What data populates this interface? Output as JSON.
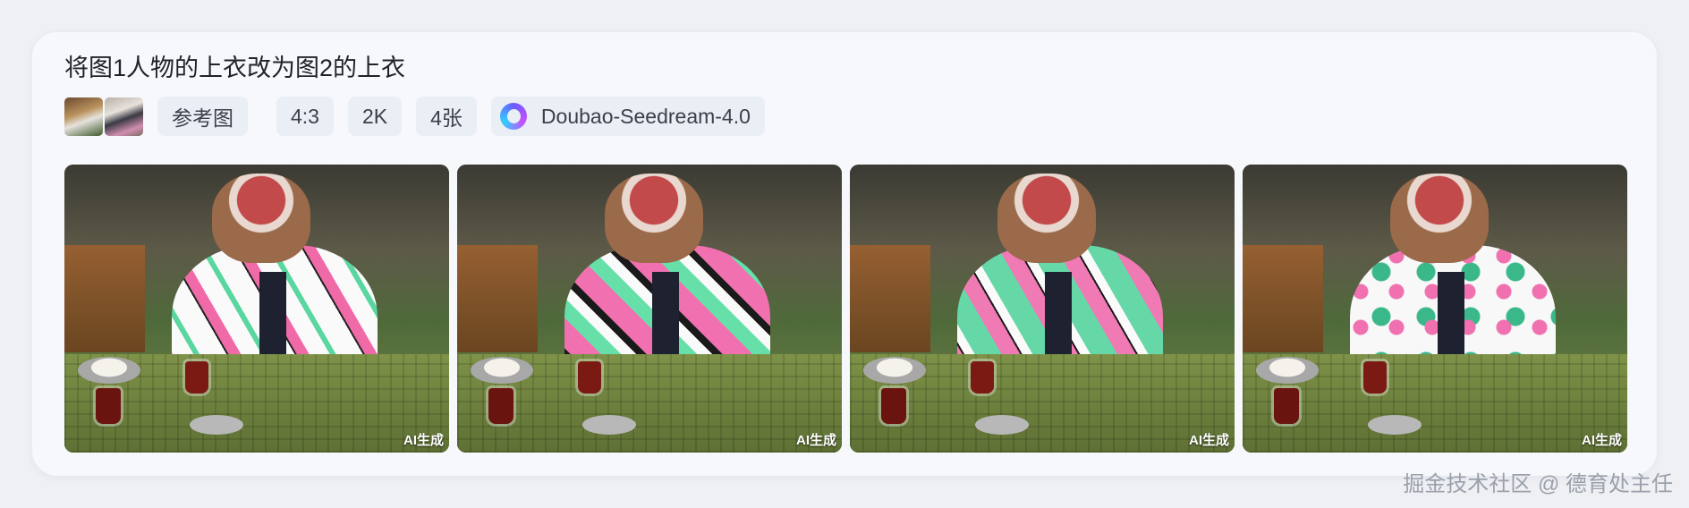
{
  "prompt": "将图1人物的上衣改为图2的上衣",
  "tags": {
    "reference_label": "参考图",
    "aspect_ratio": "4:3",
    "resolution": "2K",
    "count": "4张",
    "model": "Doubao-Seedream-4.0"
  },
  "images": [
    {
      "badge": "AI生成"
    },
    {
      "badge": "AI生成"
    },
    {
      "badge": "AI生成"
    },
    {
      "badge": "AI生成"
    }
  ],
  "watermark": "掘金技术社区 @ 德育处主任"
}
